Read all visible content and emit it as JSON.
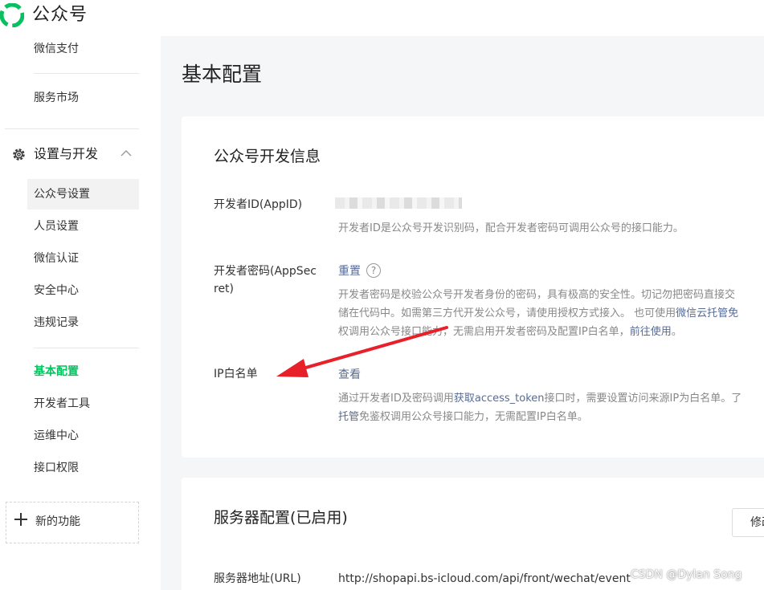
{
  "app": {
    "brand": "公众号",
    "brand_color": "#07c160",
    "logo_icon": "wechat-official-account-logo"
  },
  "sidebar": {
    "top_items": [
      {
        "label": "微信支付"
      },
      {
        "label": "服务市场"
      }
    ],
    "group": {
      "label": "设置与开发",
      "icon": "gear-icon",
      "expanded": true,
      "items": [
        {
          "label": "公众号设置",
          "highlighted": true
        },
        {
          "label": "人员设置"
        },
        {
          "label": "微信认证"
        },
        {
          "label": "安全中心"
        },
        {
          "label": "违规记录"
        }
      ],
      "dev_items": [
        {
          "label": "基本配置",
          "current": true
        },
        {
          "label": "开发者工具"
        },
        {
          "label": "运维中心"
        },
        {
          "label": "接口权限"
        }
      ]
    },
    "new_feature": {
      "label": "新的功能",
      "icon": "plus-icon"
    }
  },
  "main": {
    "page_title": "基本配置",
    "dev_info": {
      "title": "公众号开发信息",
      "appid": {
        "label": "开发者ID(AppID)",
        "desc": "开发者ID是公众号开发识别码，配合开发者密码可调用公众号的接口能力。"
      },
      "appsecret": {
        "label_line1": "开发者密码(AppSec",
        "label_line2": "ret)",
        "action": "重置",
        "help": "?",
        "desc_line1": "开发者密码是校验公众号开发者身份的密码，具有极高的安全性。切记勿把密码直接交",
        "desc_line2": "储在代码中。如需第三方代开发公众号，请使用授权方式接入。 也可使用",
        "desc_line2_link": "微信云托管免",
        "desc_line3": "权调用公众号接口能力，无需启用开发者密码及配置IP白名单，",
        "desc_line3_link": "前往使用",
        "desc_line3_end": "。"
      },
      "ip_whitelist": {
        "label": "IP白名单",
        "action": "查看",
        "desc_line1_start": "通过开发者ID及密码调用",
        "desc_line1_link": "获取access_token",
        "desc_line1_end": "接口时，需要设置访问来源IP为白名单。了",
        "desc_line2_link": "托管",
        "desc_line2_end": "免鉴权调用公众号接口能力，无需配置IP白名单。"
      }
    },
    "server_config": {
      "title": "服务器配置(已启用)",
      "modify_button": "修改",
      "url": {
        "label": "服务器地址(URL)",
        "value": "http://shopapi.bs-icloud.com/api/front/wechat/event"
      }
    }
  },
  "annotation": {
    "color": "#e8202a"
  },
  "watermark": "CSDN @Dylan  Song"
}
